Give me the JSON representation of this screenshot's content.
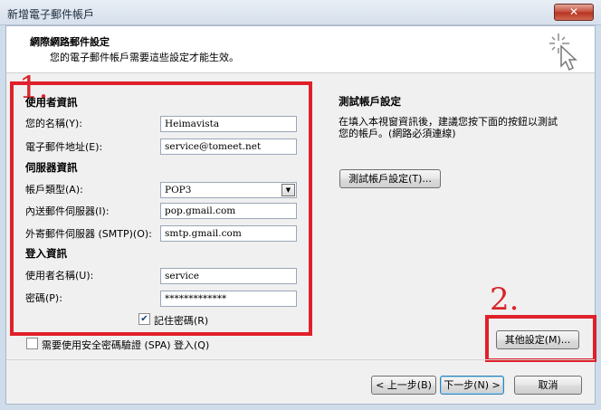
{
  "window": {
    "title": "新增電子郵件帳戶",
    "close_label": "✕"
  },
  "header": {
    "title": "網際網路郵件設定",
    "subtitle": "您的電子郵件帳戶需要這些設定才能生效。"
  },
  "annotations": {
    "step1": "1.",
    "step2": "2."
  },
  "user_info": {
    "section_title": "使用者資訊",
    "name_label": "您的名稱(Y):",
    "name_value": "Heimavista",
    "email_label": "電子郵件地址(E):",
    "email_value": "service@tomeet.net"
  },
  "server_info": {
    "section_title": "伺服器資訊",
    "account_type_label": "帳戶類型(A):",
    "account_type_value": "POP3",
    "incoming_label": "內送郵件伺服器(I):",
    "incoming_value": "pop.gmail.com",
    "outgoing_label": "外寄郵件伺服器 (SMTP)(O):",
    "outgoing_value": "smtp.gmail.com"
  },
  "login_info": {
    "section_title": "登入資訊",
    "username_label": "使用者名稱(U):",
    "username_value": "service",
    "password_label": "密碼(P):",
    "password_value": "*************",
    "remember_label": "記住密碼(R)",
    "remember_checked": true
  },
  "spa": {
    "label": "需要使用安全密碼驗證 (SPA) 登入(Q)",
    "checked": false
  },
  "test": {
    "title": "測試帳戶設定",
    "description_line1": "在填入本視窗資訊後，建議您按下面的按鈕以測試",
    "description_line2": "您的帳戶。(網路必須連線)",
    "button_label": "測試帳戶設定(T)..."
  },
  "more_settings_label": "其他設定(M)...",
  "nav": {
    "back_label": "< 上一步(B)",
    "next_label": "下一步(N) >",
    "cancel_label": "取消"
  }
}
